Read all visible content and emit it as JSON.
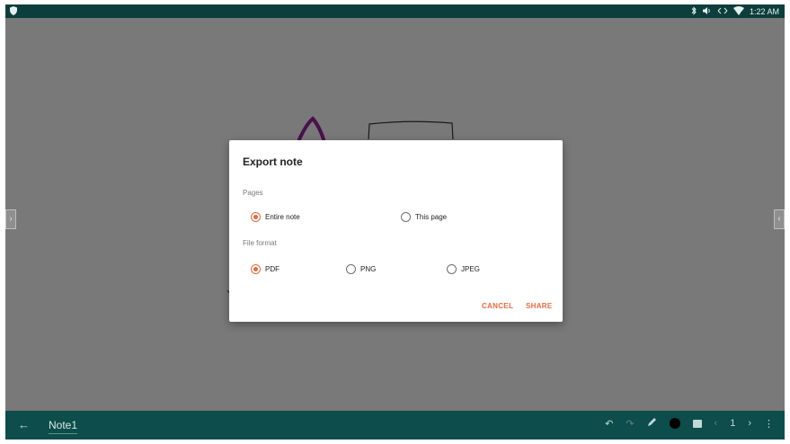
{
  "statusbar": {
    "time": "1:22 AM",
    "icons": [
      "shield-icon",
      "bluetooth-icon",
      "volume-icon",
      "data-transfer-icon",
      "wifi-icon"
    ]
  },
  "note": {
    "title": "Note1"
  },
  "dialog": {
    "title": "Export note",
    "pages_label": "Pages",
    "pages_options": [
      "Entire note",
      "This page"
    ],
    "pages_selected": "Entire note",
    "format_label": "File format",
    "format_options": [
      "PDF",
      "PNG",
      "JPEG"
    ],
    "format_selected": "PDF",
    "cancel_label": "CANCEL",
    "share_label": "SHARE"
  },
  "toolbar": {
    "page_number": "1",
    "pen_color": "#000000",
    "icons": [
      "back-arrow-icon",
      "undo-icon",
      "redo-icon",
      "pen-icon",
      "color-dot-icon",
      "image-icon",
      "prev-page-icon",
      "next-page-icon",
      "more-icon"
    ]
  },
  "colors": {
    "statusbar": "#0c3e3c",
    "toolbar": "#0d4d4b",
    "accent": "#e8693d",
    "scrim": "#797979"
  }
}
